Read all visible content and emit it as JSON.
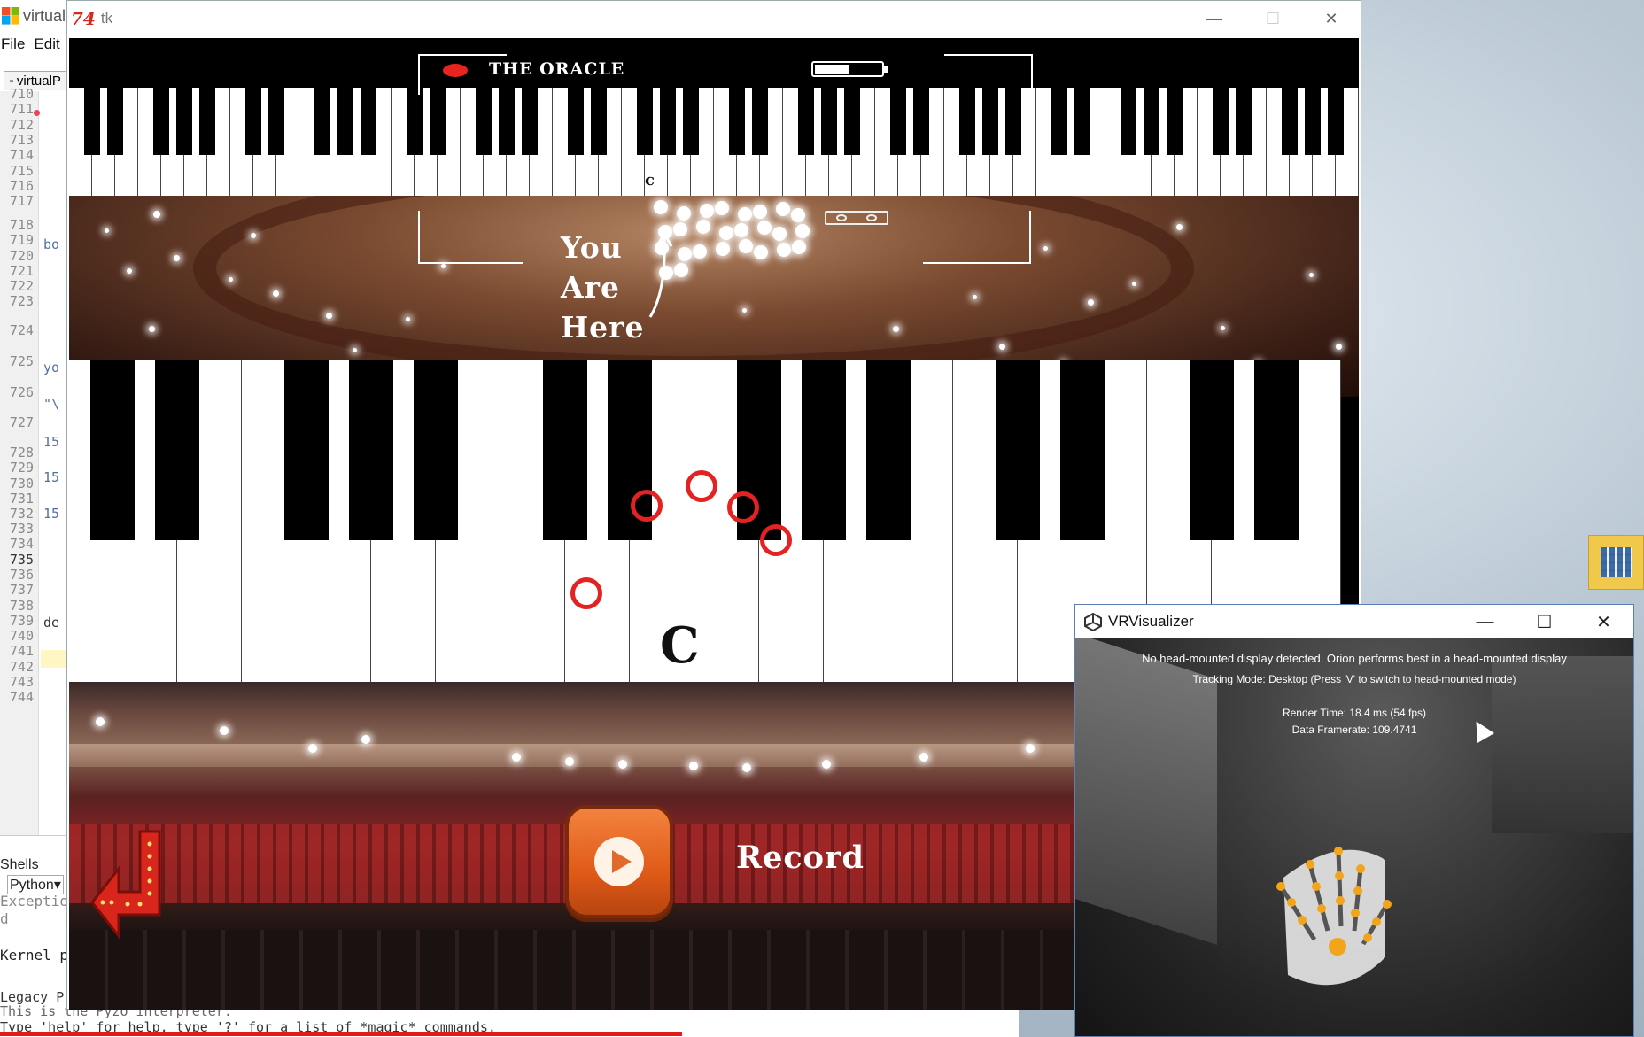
{
  "editor": {
    "title_partial": "virtual",
    "menu": [
      "File",
      "Edit"
    ],
    "tab_label": "virtualP",
    "line_numbers": [
      "710",
      "711",
      "712",
      "713",
      "714",
      "715",
      "716",
      "717",
      "718",
      "719",
      "720",
      "721",
      "722",
      "723",
      "724",
      "725",
      "726",
      "727",
      "728",
      "729",
      "730",
      "731",
      "732",
      "733",
      "734",
      "735",
      "736",
      "737",
      "738",
      "739",
      "740",
      "741",
      "742",
      "743",
      "744"
    ],
    "active_line": "735",
    "code_fragments": [
      "bo",
      "yo",
      "\"\\",
      "15",
      "15",
      "15",
      "de"
    ],
    "shells_label": "Shells",
    "shell_lang": "Python",
    "shell_lines": [
      "Exceptio",
      "d",
      "Kernel p"
    ],
    "console_lines": [
      "Legacy P",
      "This is the Pyzo interpreter.",
      "Type 'help' for help, type '?' for a list of *magic* commands."
    ]
  },
  "tk_window": {
    "title": "tk",
    "logo": "74",
    "controls": [
      "—",
      "☐",
      "✕"
    ],
    "hud_title": "THE ORACLE",
    "mini_note": "c",
    "overlay_text": [
      "You",
      "Are",
      "Here"
    ],
    "big_note": "C",
    "record_label": "Record",
    "icons": [
      "record-dot-icon",
      "battery-icon",
      "cassette-icon",
      "curved-arrow-icon",
      "back-arrow-icon",
      "play-icon"
    ]
  },
  "vr_window": {
    "title": "VRVisualizer",
    "controls": [
      "—",
      "☐",
      "✕"
    ],
    "line1": "No head-mounted display detected. Orion performs best in a head-mounted display",
    "line2": "Tracking Mode: Desktop (Press 'V' to switch to head-mounted mode)",
    "line3": "Render Time: 18.4 ms (54 fps)",
    "line4": "Data Framerate: 109.4741"
  },
  "colors": {
    "record_red": "#e8241e",
    "finger_ring": "#e52222",
    "play_orange": "#e05a18",
    "hand_joint": "#f2a51a"
  }
}
